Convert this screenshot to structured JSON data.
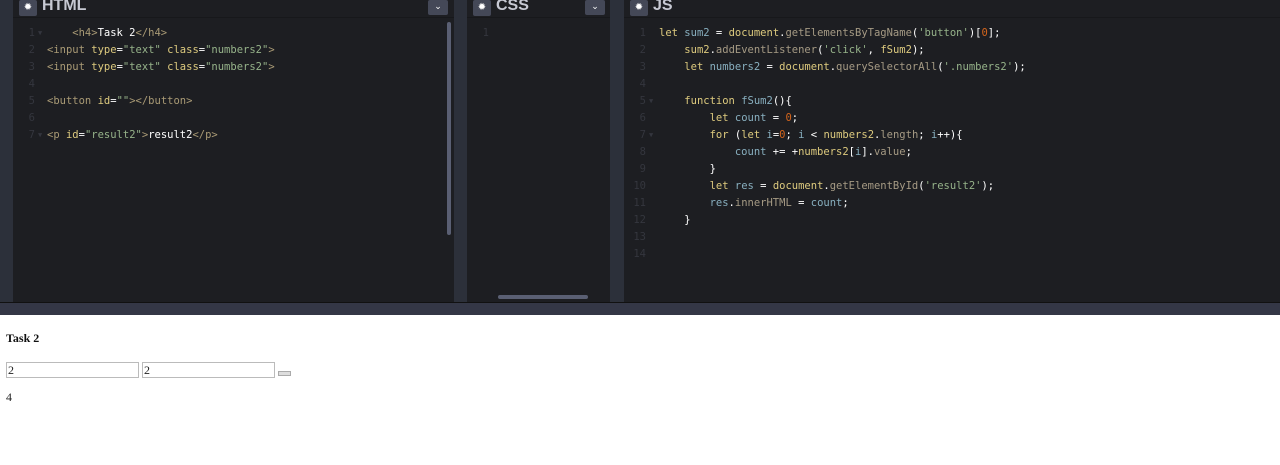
{
  "panels": {
    "html": {
      "title": "HTML",
      "lines": [
        [
          [
            "t-tag",
            "    <h4>"
          ],
          [
            "t-text",
            "Task 2"
          ],
          [
            "t-tag",
            "</h4>"
          ]
        ],
        [
          [
            "t-tag",
            "<input "
          ],
          [
            "t-attr",
            "type"
          ],
          [
            "t-p",
            "="
          ],
          [
            "t-str",
            "\"text\" "
          ],
          [
            "t-attr",
            "class"
          ],
          [
            "t-p",
            "="
          ],
          [
            "t-str",
            "\"numbers2\""
          ],
          [
            "t-tag",
            ">"
          ]
        ],
        [
          [
            "t-tag",
            "<input "
          ],
          [
            "t-attr",
            "type"
          ],
          [
            "t-p",
            "="
          ],
          [
            "t-str",
            "\"text\" "
          ],
          [
            "t-attr",
            "class"
          ],
          [
            "t-p",
            "="
          ],
          [
            "t-str",
            "\"numbers2\""
          ],
          [
            "t-tag",
            ">"
          ]
        ],
        [],
        [
          [
            "t-tag",
            "<button "
          ],
          [
            "t-attr",
            "id"
          ],
          [
            "t-p",
            "="
          ],
          [
            "t-str",
            "\"\""
          ],
          [
            "t-tag",
            "></button>"
          ]
        ],
        [],
        [
          [
            "t-tag",
            "<p "
          ],
          [
            "t-attr",
            "id"
          ],
          [
            "t-p",
            "="
          ],
          [
            "t-str",
            "\"result2\""
          ],
          [
            "t-tag",
            ">"
          ],
          [
            "t-text",
            "result2"
          ],
          [
            "t-tag",
            "</p>"
          ]
        ]
      ],
      "folds": [
        1,
        7
      ]
    },
    "css": {
      "title": "CSS",
      "lines": [
        []
      ],
      "folds": []
    },
    "js": {
      "title": "JS",
      "lines": [
        [
          [
            "t-kw",
            "let "
          ],
          [
            "t-var",
            "sum2"
          ],
          [
            "t-p",
            " = "
          ],
          [
            "t-bi",
            "document"
          ],
          [
            "t-p",
            "."
          ],
          [
            "t-prop",
            "getElementsByTagName"
          ],
          [
            "t-p",
            "("
          ],
          [
            "t-str",
            "'button'"
          ],
          [
            "t-p",
            ")["
          ],
          [
            "t-num",
            "0"
          ],
          [
            "t-p",
            "];"
          ]
        ],
        [
          [
            "t-p",
            "    "
          ],
          [
            "t-fn",
            "sum2"
          ],
          [
            "t-p",
            "."
          ],
          [
            "t-prop",
            "addEventListener"
          ],
          [
            "t-p",
            "("
          ],
          [
            "t-str",
            "'click'"
          ],
          [
            "t-p",
            ", "
          ],
          [
            "t-fn",
            "fSum2"
          ],
          [
            "t-p",
            ");"
          ]
        ],
        [
          [
            "t-p",
            "    "
          ],
          [
            "t-kw",
            "let "
          ],
          [
            "t-var",
            "numbers2"
          ],
          [
            "t-p",
            " = "
          ],
          [
            "t-bi",
            "document"
          ],
          [
            "t-p",
            "."
          ],
          [
            "t-prop",
            "querySelectorAll"
          ],
          [
            "t-p",
            "("
          ],
          [
            "t-str",
            "'.numbers2'"
          ],
          [
            "t-p",
            ");"
          ]
        ],
        [],
        [
          [
            "t-p",
            "    "
          ],
          [
            "t-kw",
            "function "
          ],
          [
            "t-var",
            "fSum2"
          ],
          [
            "t-p",
            "(){"
          ]
        ],
        [
          [
            "t-p",
            "        "
          ],
          [
            "t-kw",
            "let "
          ],
          [
            "t-var",
            "count"
          ],
          [
            "t-p",
            " = "
          ],
          [
            "t-num",
            "0"
          ],
          [
            "t-p",
            ";"
          ]
        ],
        [
          [
            "t-p",
            "        "
          ],
          [
            "t-kw",
            "for "
          ],
          [
            "t-p",
            "("
          ],
          [
            "t-kw",
            "let "
          ],
          [
            "t-var",
            "i"
          ],
          [
            "t-p",
            "="
          ],
          [
            "t-num",
            "0"
          ],
          [
            "t-p",
            "; "
          ],
          [
            "t-var",
            "i"
          ],
          [
            "t-p",
            " < "
          ],
          [
            "t-fn",
            "numbers2"
          ],
          [
            "t-p",
            "."
          ],
          [
            "t-prop",
            "length"
          ],
          [
            "t-p",
            "; "
          ],
          [
            "t-var",
            "i"
          ],
          [
            "t-p",
            "++){"
          ]
        ],
        [
          [
            "t-p",
            "            "
          ],
          [
            "t-var",
            "count"
          ],
          [
            "t-p",
            " += +"
          ],
          [
            "t-fn",
            "numbers2"
          ],
          [
            "t-p",
            "["
          ],
          [
            "t-var",
            "i"
          ],
          [
            "t-p",
            "]."
          ],
          [
            "t-prop",
            "value"
          ],
          [
            "t-p",
            ";"
          ]
        ],
        [
          [
            "t-p",
            "        }"
          ]
        ],
        [
          [
            "t-p",
            "        "
          ],
          [
            "t-kw",
            "let "
          ],
          [
            "t-var",
            "res"
          ],
          [
            "t-p",
            " = "
          ],
          [
            "t-bi",
            "document"
          ],
          [
            "t-p",
            "."
          ],
          [
            "t-prop",
            "getElementById"
          ],
          [
            "t-p",
            "("
          ],
          [
            "t-str",
            "'result2'"
          ],
          [
            "t-p",
            ");"
          ]
        ],
        [
          [
            "t-p",
            "        "
          ],
          [
            "t-var",
            "res"
          ],
          [
            "t-p",
            "."
          ],
          [
            "t-prop",
            "innerHTML"
          ],
          [
            "t-p",
            " = "
          ],
          [
            "t-var",
            "count"
          ],
          [
            "t-p",
            ";"
          ]
        ],
        [
          [
            "t-p",
            "    }"
          ]
        ],
        [],
        []
      ],
      "folds": [
        5,
        7
      ]
    }
  },
  "preview": {
    "heading": "Task 2",
    "input1": "2",
    "input2": "2",
    "result": "4"
  }
}
